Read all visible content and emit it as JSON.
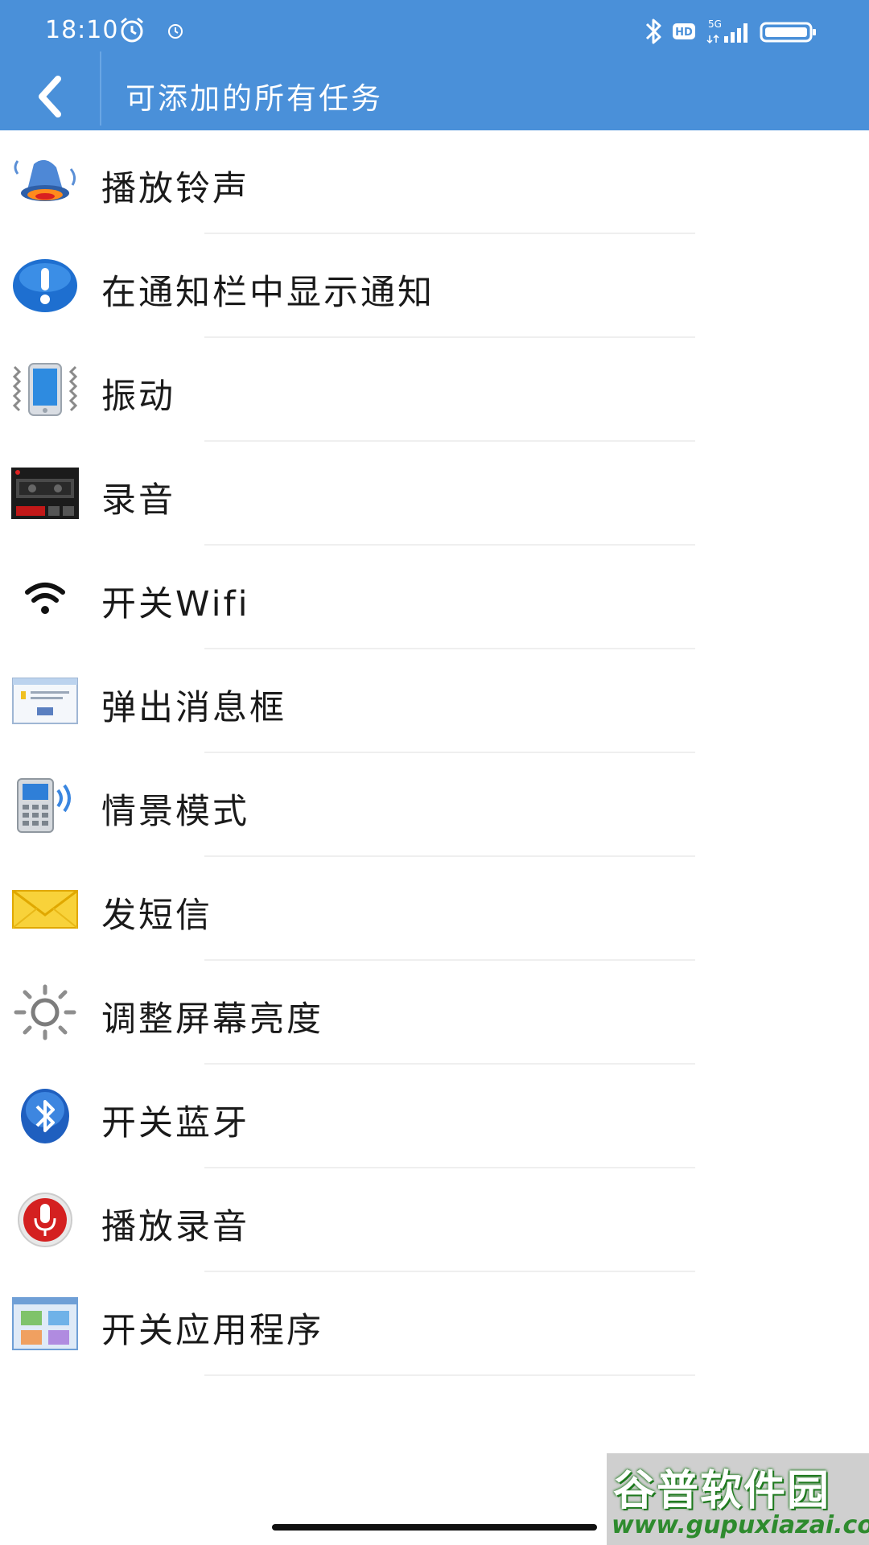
{
  "status_bar": {
    "time": "18:10",
    "icons_left": [
      "alarm-icon",
      "notification-dot-icon"
    ],
    "icons_right": [
      "bluetooth-icon",
      "hd-icon",
      "5g-signal-icon",
      "battery-icon"
    ],
    "hd_label": "HD",
    "network_label": "5G"
  },
  "app_bar": {
    "title": "可添加的所有任务",
    "back_icon": "chevron-left-icon",
    "background_color": "#4a90d9"
  },
  "tasks": [
    {
      "label": "播放铃声",
      "icon": "bell-icon"
    },
    {
      "label": "在通知栏中显示通知",
      "icon": "notification-exclamation-icon"
    },
    {
      "label": "振动",
      "icon": "vibrate-phone-icon"
    },
    {
      "label": "录音",
      "icon": "recorder-icon"
    },
    {
      "label": "开关Wifi",
      "icon": "wifi-icon"
    },
    {
      "label": "弹出消息框",
      "icon": "dialog-box-icon"
    },
    {
      "label": "情景模式",
      "icon": "profile-phone-icon"
    },
    {
      "label": "发短信",
      "icon": "envelope-icon"
    },
    {
      "label": "调整屏幕亮度",
      "icon": "brightness-sun-icon"
    },
    {
      "label": "开关蓝牙",
      "icon": "bluetooth-circle-icon"
    },
    {
      "label": "播放录音",
      "icon": "microphone-icon"
    },
    {
      "label": "开关应用程序",
      "icon": "apps-grid-icon"
    }
  ],
  "watermark": {
    "title": "谷普软件园",
    "url": "www.gupuxiazai.com"
  }
}
